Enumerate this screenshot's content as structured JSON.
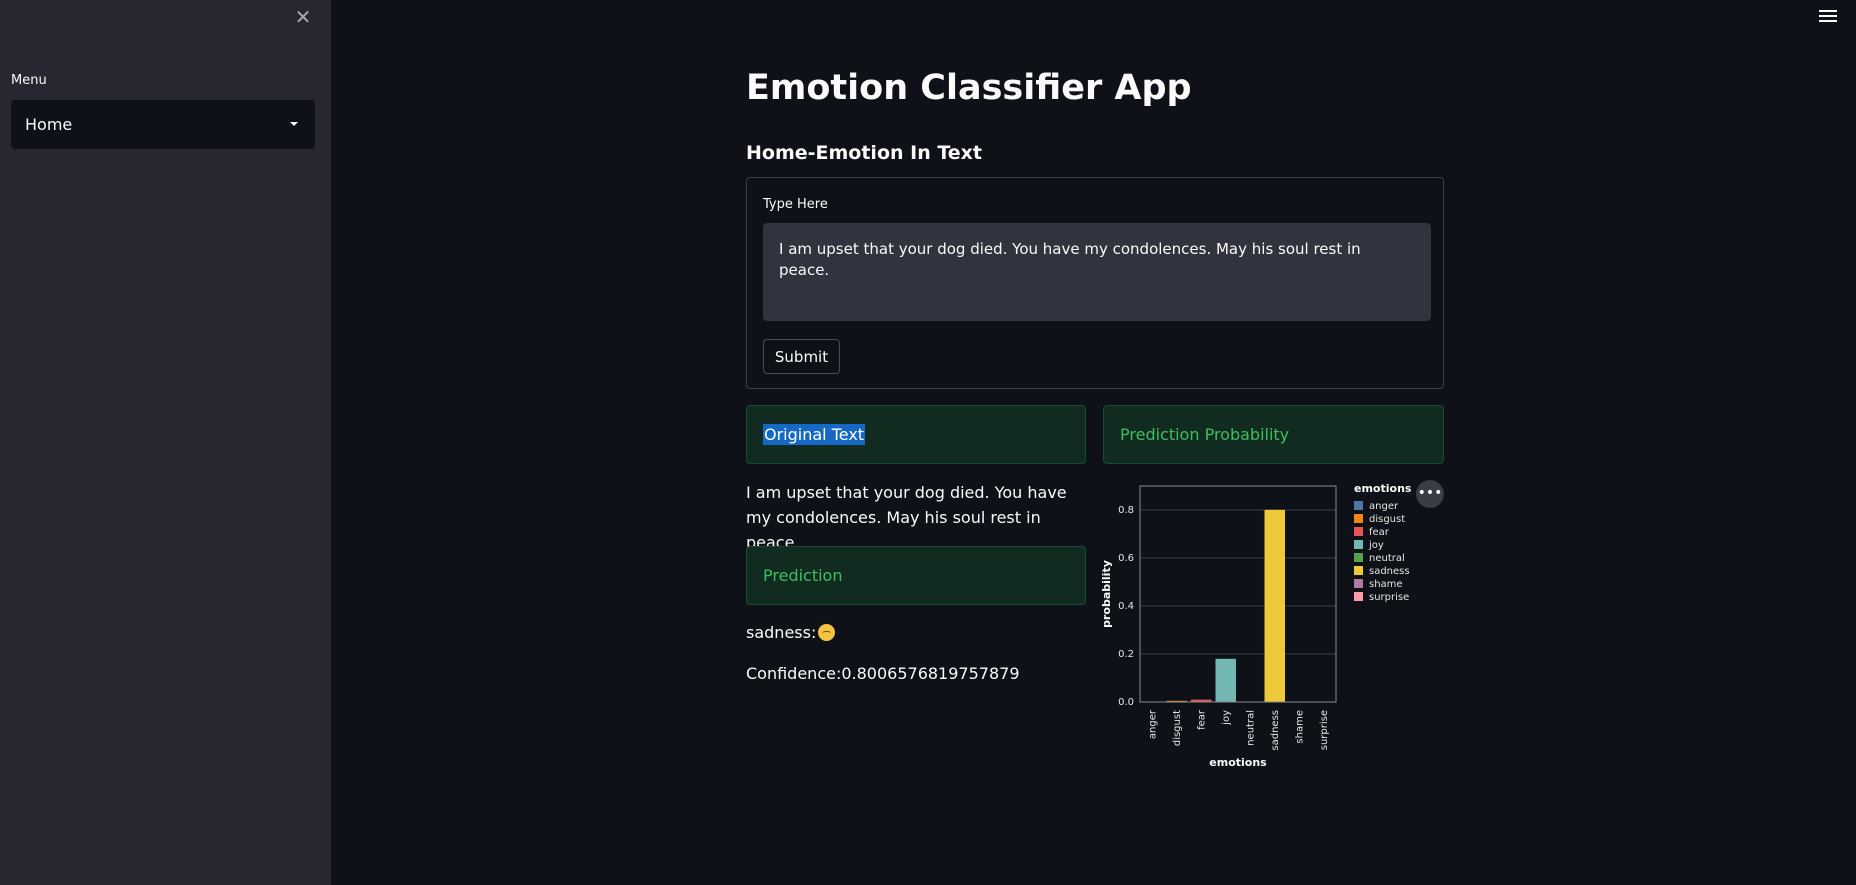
{
  "sidebar": {
    "menu_label": "Menu",
    "selected": "Home",
    "close_icon": "close-icon"
  },
  "header": {
    "menu_icon": "hamburger-icon"
  },
  "main": {
    "title": "Emotion Classifier App",
    "subtitle": "Home-Emotion In Text",
    "form": {
      "input_label": "Type Here",
      "input_value": "I am upset that your dog died. You have my condolences. May his soul rest in peace.",
      "submit_label": "Submit"
    },
    "original_text_header": "Original Text",
    "original_text": "I am upset that your dog died. You have my condolences. May his soul rest in peace.",
    "prediction_header": "Prediction",
    "prediction_label": "sadness:",
    "prediction_emoji": "pensive-face-icon",
    "confidence": "Confidence:0.8006576819757879",
    "probability_header": "Prediction Probability"
  },
  "chart_data": {
    "type": "bar",
    "categories": [
      "anger",
      "disgust",
      "fear",
      "joy",
      "neutral",
      "sadness",
      "shame",
      "surprise"
    ],
    "values": [
      0.001,
      0.005,
      0.01,
      0.18,
      0.0,
      0.8007,
      0.001,
      0.001
    ],
    "colors": [
      "#4c78a8",
      "#f58518",
      "#e45756",
      "#72b7b2",
      "#54a24b",
      "#eeca3b",
      "#b279a2",
      "#ff9da6"
    ],
    "xlabel": "emotions",
    "ylabel": "probability",
    "ylim": [
      0,
      0.9
    ],
    "yticks": [
      "0.0",
      "0.2",
      "0.4",
      "0.6",
      "0.8"
    ],
    "legend_title": "emotions",
    "legend_position": "right",
    "grid": true
  },
  "colors": {
    "background": "#0e1117",
    "sidebar": "#262730",
    "info_green": "#3fbe5f",
    "highlight": "#1668c7"
  }
}
